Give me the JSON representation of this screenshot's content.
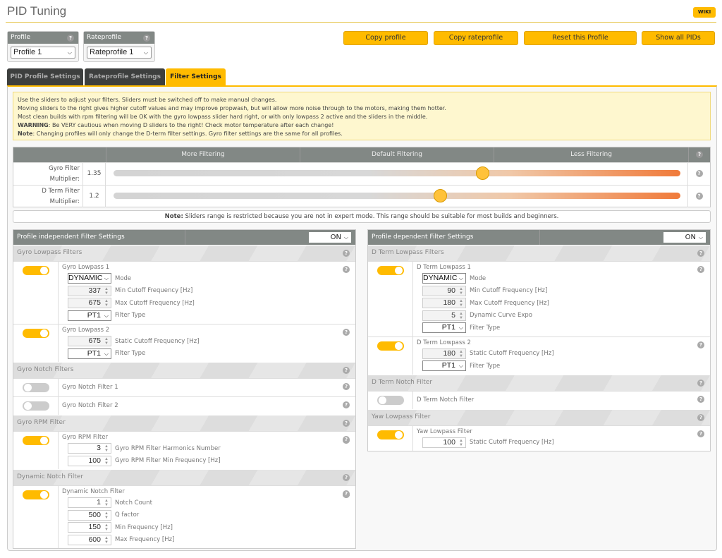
{
  "header": {
    "title": "PID Tuning",
    "wiki": "WIKI"
  },
  "profile": {
    "label": "Profile",
    "value": "Profile 1"
  },
  "rateprofile": {
    "label": "Rateprofile",
    "value": "Rateprofile 1"
  },
  "buttons": [
    "Copy profile",
    "Copy rateprofile",
    "Reset this Profile",
    "Show all PIDs"
  ],
  "tabs": [
    {
      "label": "PID Profile Settings",
      "active": false
    },
    {
      "label": "Rateprofile Settings",
      "active": false
    },
    {
      "label": "Filter Settings",
      "active": true
    }
  ],
  "info": {
    "lines": [
      "Use the sliders to adjust your filters. Sliders must be switched off to make manual changes.",
      "Moving sliders to the right gives higher cutoff values and may improve propwash, but will allow more noise through to the motors, making them hotter.",
      "Most clean builds with rpm filtering will be OK with the gyro lowpass slider hard right, or with only lowpass 2 active and the sliders in the middle."
    ],
    "warning_label": "WARNING",
    "warning": ": Be VERY cautious when moving D sliders to the right! Check motor temperature after each change!",
    "note_label": "Note",
    "note": ": Changing profiles will only change the D-term filter settings. Gyro filter settings are the same for all profiles."
  },
  "sliders": {
    "headers": [
      "More Filtering",
      "Default Filtering",
      "Less Filtering"
    ],
    "rows": [
      {
        "label1": "Gyro Filter",
        "label2": "Multiplier:",
        "value": "1.35",
        "position_fraction": 0.65
      },
      {
        "label1": "D Term Filter",
        "label2": "Multiplier:",
        "value": "1.2",
        "position_fraction": 0.576
      }
    ],
    "note_label": "Note:",
    "note": " Sliders range is restricted because you are not in expert mode. This range should be suitable for most builds and beginners."
  },
  "colors": {
    "accent": "#ffbb00",
    "header_gray": "#828885",
    "tab_dark": "#3d3f3e"
  },
  "panels": [
    {
      "title": "Profile independent Filter Settings",
      "state": "ON",
      "sections": [
        {
          "title": "Gyro Lowpass Filters",
          "rows": [
            {
              "name": "Gyro Lowpass 1",
              "on": true,
              "fields": [
                {
                  "kind": "select",
                  "value": "DYNAMIC",
                  "label": "Mode"
                },
                {
                  "kind": "num",
                  "value": "337",
                  "label": "Min Cutoff Frequency [Hz]"
                },
                {
                  "kind": "num",
                  "value": "675",
                  "label": "Max Cutoff Frequency [Hz]"
                },
                {
                  "kind": "select",
                  "value": "PT1",
                  "label": "Filter Type"
                }
              ]
            },
            {
              "name": "Gyro Lowpass 2",
              "on": true,
              "fields": [
                {
                  "kind": "num",
                  "value": "675",
                  "label": "Static Cutoff Frequency [Hz]"
                },
                {
                  "kind": "select",
                  "value": "PT1",
                  "label": "Filter Type"
                }
              ]
            }
          ]
        },
        {
          "title": "Gyro Notch Filters",
          "rows": [
            {
              "name": "Gyro Notch Filter 1",
              "on": false,
              "fields": []
            },
            {
              "name": "Gyro Notch Filter 2",
              "on": false,
              "fields": []
            }
          ]
        },
        {
          "title": "Gyro RPM Filter",
          "rows": [
            {
              "name": "Gyro RPM Filter",
              "on": true,
              "fields": [
                {
                  "kind": "numw",
                  "value": "3",
                  "label": "Gyro RPM Filter Harmonics Number",
                  "help": true
                },
                {
                  "kind": "numw",
                  "value": "100",
                  "label": "Gyro RPM Filter Min Frequency [Hz]",
                  "help": true
                }
              ]
            }
          ]
        },
        {
          "title": "Dynamic Notch Filter",
          "rows": [
            {
              "name": "Dynamic Notch Filter",
              "on": true,
              "fields": [
                {
                  "kind": "numw",
                  "value": "1",
                  "label": "Notch Count",
                  "help": true
                },
                {
                  "kind": "numw",
                  "value": "500",
                  "label": "Q factor",
                  "help": true
                },
                {
                  "kind": "numw",
                  "value": "150",
                  "label": "Min Frequency [Hz]",
                  "help": true
                },
                {
                  "kind": "numw",
                  "value": "600",
                  "label": "Max Frequency [Hz]",
                  "help": true
                }
              ]
            }
          ]
        }
      ]
    },
    {
      "title": "Profile dependent Filter Settings",
      "state": "ON",
      "sections": [
        {
          "title": "D Term Lowpass Filters",
          "rows": [
            {
              "name": "D Term Lowpass 1",
              "on": true,
              "fields": [
                {
                  "kind": "select",
                  "value": "DYNAMIC",
                  "label": "Mode"
                },
                {
                  "kind": "num",
                  "value": "90",
                  "label": "Min Cutoff Frequency [Hz]"
                },
                {
                  "kind": "num",
                  "value": "180",
                  "label": "Max Cutoff Frequency [Hz]"
                },
                {
                  "kind": "num",
                  "value": "5",
                  "label": "Dynamic Curve Expo"
                },
                {
                  "kind": "select",
                  "value": "PT1",
                  "label": "Filter Type"
                }
              ]
            },
            {
              "name": "D Term Lowpass 2",
              "on": true,
              "fields": [
                {
                  "kind": "num",
                  "value": "180",
                  "label": "Static Cutoff Frequency [Hz]"
                },
                {
                  "kind": "select",
                  "value": "PT1",
                  "label": "Filter Type"
                }
              ]
            }
          ]
        },
        {
          "title": "D Term Notch Filter",
          "rows": [
            {
              "name": "D Term Notch Filter",
              "on": false,
              "fields": []
            }
          ]
        },
        {
          "title": "Yaw Lowpass Filter",
          "rows": [
            {
              "name": "Yaw Lowpass Filter",
              "on": true,
              "fields": [
                {
                  "kind": "numw",
                  "value": "100",
                  "label": "Static Cutoff Frequency [Hz]"
                }
              ]
            }
          ]
        }
      ]
    }
  ]
}
